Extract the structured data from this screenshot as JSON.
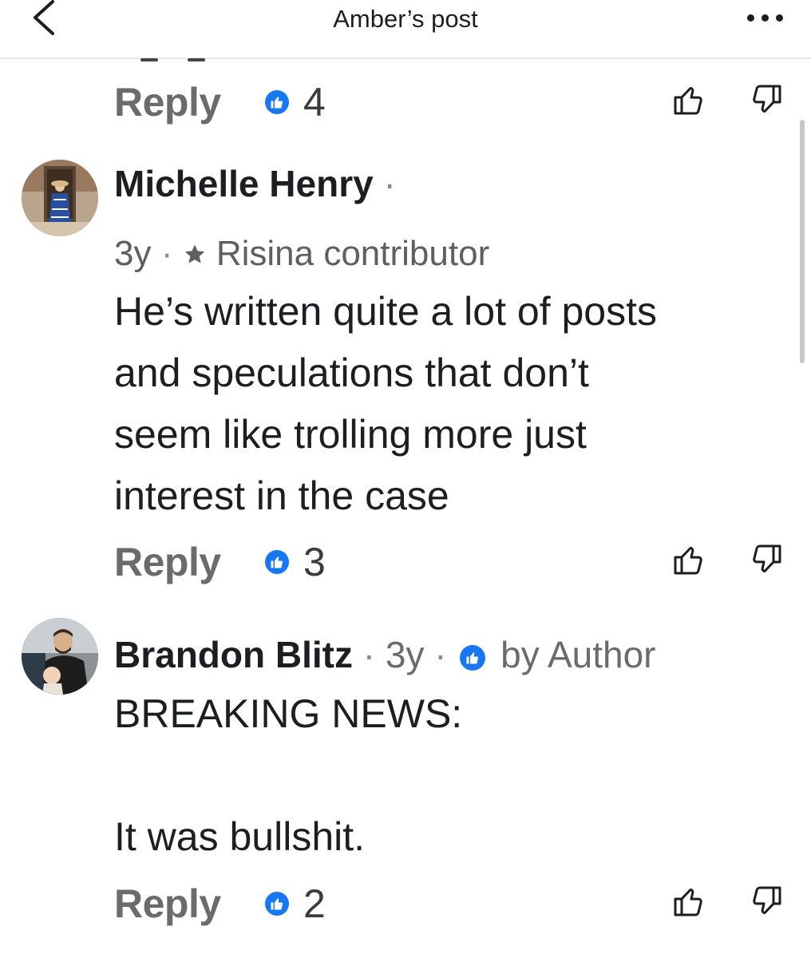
{
  "header": {
    "title": "Amber’s post"
  },
  "comments": [
    {
      "reply_label": "Reply",
      "like_count": "4"
    },
    {
      "author": "Michelle Henry",
      "time": "3y",
      "badge": "Risina contributor",
      "text": "He’s written quite a lot of posts\nand speculations that don’t\nseem like trolling more just\ninterest in the case",
      "reply_label": "Reply",
      "like_count": "3"
    },
    {
      "author": "Brandon  Blitz",
      "time": "3y",
      "liked_by": "by Author",
      "text": "BREAKING NEWS:\n\nIt was bullshit.",
      "reply_label": "Reply",
      "like_count": "2"
    }
  ],
  "icons": {
    "back": "chevron-left-icon",
    "more": "more-horizontal-icon",
    "like": "thumbs-up-icon",
    "dislike": "thumbs-down-icon",
    "contributor": "star-badge-icon"
  },
  "colors": {
    "accent": "#1877f2",
    "text": "#1c1e21",
    "muted": "#6b6b6b"
  }
}
